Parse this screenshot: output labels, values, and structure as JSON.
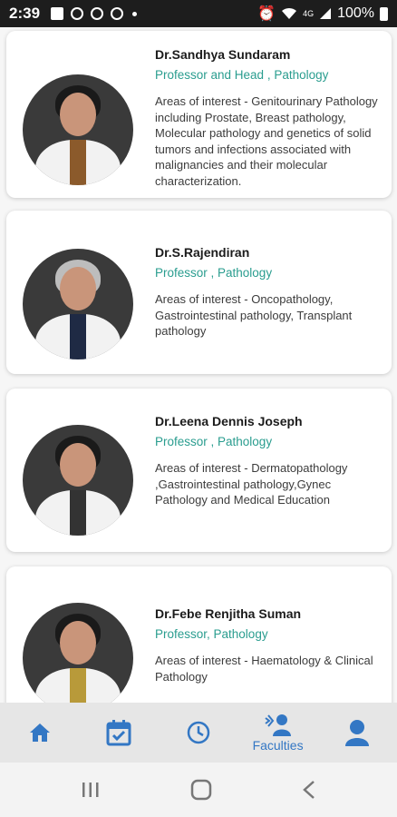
{
  "status_bar": {
    "time": "2:39",
    "battery": "100%",
    "network": "4G"
  },
  "doctors": [
    {
      "name": "Dr.Sandhya Sundaram",
      "title": "Professor  and Head , Pathology",
      "areas": "Areas of interest - Genitourinary Pathology including Prostate, Breast pathology, Molecular pathology and genetics of solid tumors and infections associated with malignancies and their molecular characterization."
    },
    {
      "name": "Dr.S.Rajendiran",
      "title": "Professor , Pathology",
      "areas": "Areas of interest -  Oncopathology, Gastrointestinal pathology, Transplant pathology"
    },
    {
      "name": "Dr.Leena Dennis Joseph",
      "title": "Professor , Pathology",
      "areas": "Areas of interest - Dermatopathology ,Gastrointestinal pathology,Gynec Pathology and Medical Education"
    },
    {
      "name": "Dr.Febe Renjitha Suman",
      "title": "Professor, Pathology",
      "areas": "Areas of interest - Haematology & Clinical Pathology"
    }
  ],
  "bottom_nav": {
    "items": [
      {
        "icon": "home-icon",
        "label": ""
      },
      {
        "icon": "calendar-check-icon",
        "label": ""
      },
      {
        "icon": "clock-icon",
        "label": ""
      },
      {
        "icon": "faculties-icon",
        "label": "Faculties"
      },
      {
        "icon": "profile-icon",
        "label": ""
      }
    ]
  },
  "colors": {
    "accent": "#3377c4",
    "title_teal": "#2a9d8f"
  }
}
